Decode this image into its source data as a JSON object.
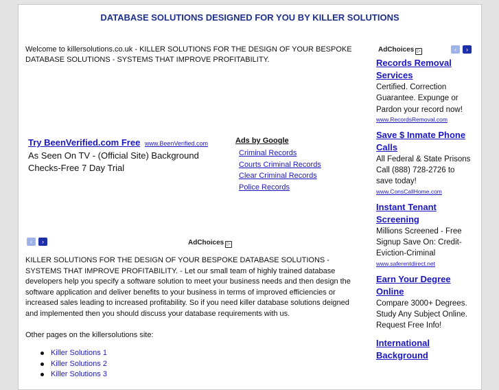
{
  "header": {
    "title": "DATABASE SOLUTIONS DESIGNED FOR YOU BY KILLER SOLUTIONS"
  },
  "welcome": "Welcome to killersolutions.co.uk - KILLER SOLUTIONS FOR THE DESIGN OF YOUR BESPOKE DATABASE SOLUTIONS - SYSTEMS THAT IMPROVE PROFITABILITY.",
  "ad_main": {
    "title": "Try BeenVerified.com Free",
    "url": "www.BeenVerified.com",
    "desc": "As Seen On TV - (Official Site) Background Checks-Free 7 Day Trial"
  },
  "ads_by_google": {
    "heading": "Ads by Google",
    "links": [
      "Criminal Records",
      "Courts Criminal Records",
      "Clear Criminal Records",
      "Police Records"
    ]
  },
  "adchoices": {
    "label": "AdChoices",
    "prev_icon": "‹",
    "next_icon": "›"
  },
  "body_text": "KILLER SOLUTIONS FOR THE DESIGN OF YOUR BESPOKE DATABASE SOLUTIONS - SYSTEMS THAT IMPROVE PROFITABILITY. - Let our small team of highly trained database developers help you specify a software solution to meet your business needs and then design the software application and deliver benefits to your business in terms of improved efficiencies or increased sales leading to increased profitability. So if you need killer database solutions deigned and implemented then you should discuss your database requirements with us.",
  "other_pages": {
    "label": "Other pages on the killersolutions site:",
    "links": [
      "Killer Solutions 1",
      "Killer Solutions 2",
      "Killer Solutions 3"
    ]
  },
  "sidebar": {
    "ads": [
      {
        "title": "Records Removal Services",
        "desc": "Certified. Correction Guarantee. Expunge or Pardon your record now!",
        "url": "www.RecordsRemoval.com"
      },
      {
        "title": "Save $ Inmate Phone Calls",
        "desc": "All Federal & State Prisons Call (888) 728-2726 to save today!",
        "url": "www.ConsCallHome.com"
      },
      {
        "title": "Instant Tenant Screening",
        "desc": "Millions Screened - Free Signup Save On: Credit-Eviction-Criminal",
        "url": "www.saferentdirect.net"
      },
      {
        "title": "Earn Your Degree Online",
        "desc": "Compare 3000+ Degrees. Study Any Subject Online. Request Free Info!",
        "url": ""
      },
      {
        "title": "International Background",
        "desc": "",
        "url": ""
      }
    ]
  }
}
